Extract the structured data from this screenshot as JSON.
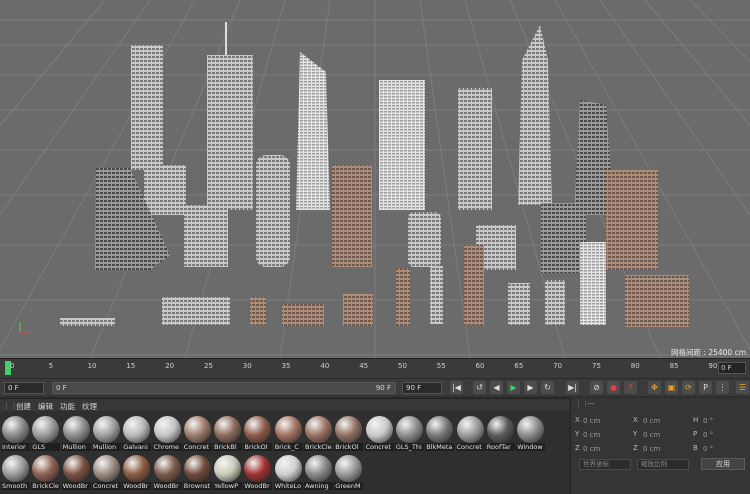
{
  "viewport": {
    "grid_spacing_label": "网格间距 : 25400 cm",
    "axis_labels": [
      "Y",
      "X"
    ]
  },
  "timeline": {
    "ticks": [
      "0",
      "5",
      "10",
      "15",
      "20",
      "25",
      "30",
      "35",
      "40",
      "45",
      "50",
      "55",
      "60",
      "65",
      "70",
      "75",
      "80",
      "85",
      "90"
    ],
    "end_frame": "0 F"
  },
  "transport": {
    "start_field": "0 F",
    "range_start": "0 F",
    "range_end": "90 F",
    "end_field": "90 F"
  },
  "material_menu": [
    "创建",
    "编辑",
    "功能",
    "纹理"
  ],
  "materials_row1": [
    "Interior",
    "GLS",
    "Mullion",
    "Mullion",
    "Galvani",
    "Chrome",
    "Concret",
    "BrickBl",
    "BrickOl",
    "Brick_C",
    "BrickCle",
    "BrickOl",
    "Concret",
    "GLS_Thi",
    "BlkMeta",
    "Concret",
    "RoofTar",
    "Window"
  ],
  "materials_row2": [
    "Smooth",
    "BrickCle",
    "WoodBr",
    "Concret",
    "WoodBr",
    "WoodBr",
    "Brownst",
    "YellowP",
    "WoodBr",
    "WhiteLo",
    "Awning",
    "GreenM"
  ],
  "attributes": {
    "rows": [
      {
        "a": "X",
        "av": "0 cm",
        "b": "X",
        "bv": "0 cm",
        "c": "H",
        "cv": "0 °"
      },
      {
        "a": "Y",
        "av": "0 cm",
        "b": "Y",
        "bv": "0 cm",
        "c": "P",
        "cv": "0 °"
      },
      {
        "a": "Z",
        "av": "0 cm",
        "b": "Z",
        "bv": "0 cm",
        "c": "B",
        "cv": "0 °"
      }
    ],
    "coord_mode": "世界坐标",
    "scale_mode": "缩放比例",
    "apply_label": "应用",
    "header_dots": "---"
  }
}
